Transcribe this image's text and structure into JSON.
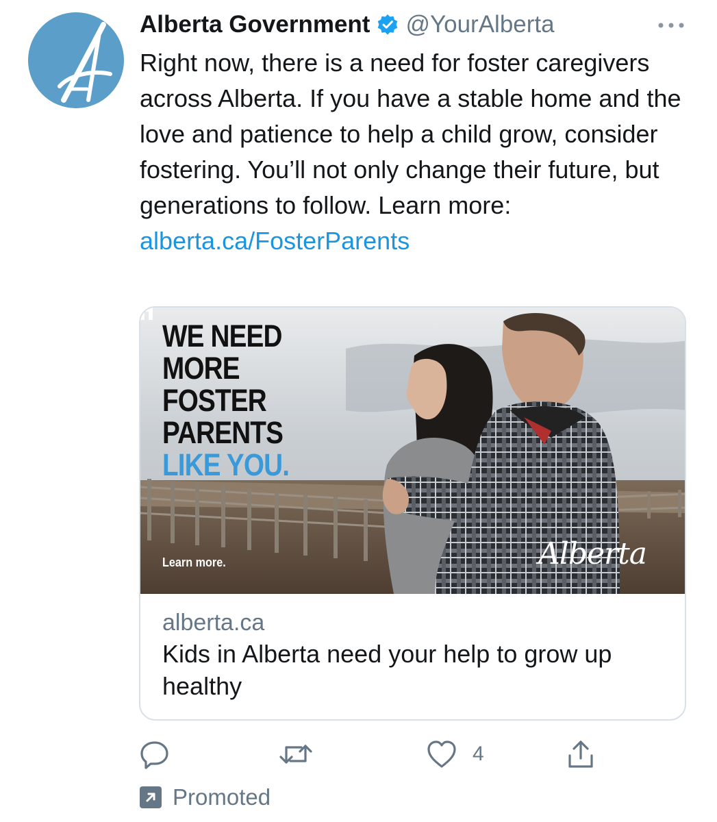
{
  "author": {
    "display_name": "Alberta Government",
    "handle": "@YourAlberta",
    "verified": true,
    "avatar_icon": "alberta-logo-avatar",
    "brand_color": "#5b9ec9"
  },
  "tweet": {
    "text": "Right now, there is a need for foster caregivers across Alberta. If you have a stable home and the love and patience to help a child grow, consider fostering. You’ll not only change their future, but generations to follow. Learn more:",
    "link_text": "alberta.ca/FosterParents",
    "more_icon": "more-horizontal-icon"
  },
  "card": {
    "image": {
      "headline_lines": [
        "WE NEED",
        "MORE",
        "FOSTER",
        "PARENTS"
      ],
      "headline_accent": "LIKE YOU.",
      "cta": "Learn more.",
      "logo_text": "Alberta",
      "accent_color": "#3a9ad9"
    },
    "domain": "alberta.ca",
    "title": "Kids in Alberta need your help to grow up healthy"
  },
  "actions": {
    "reply_icon": "reply-icon",
    "retweet_icon": "retweet-icon",
    "like_icon": "heart-icon",
    "like_count": "4",
    "share_icon": "share-icon"
  },
  "promoted": {
    "label": "Promoted",
    "icon": "promoted-arrow-icon"
  },
  "colors": {
    "link": "#1b95e0",
    "secondary_text": "#657786",
    "verified": "#1da1f2",
    "border": "#d9e1e8"
  }
}
